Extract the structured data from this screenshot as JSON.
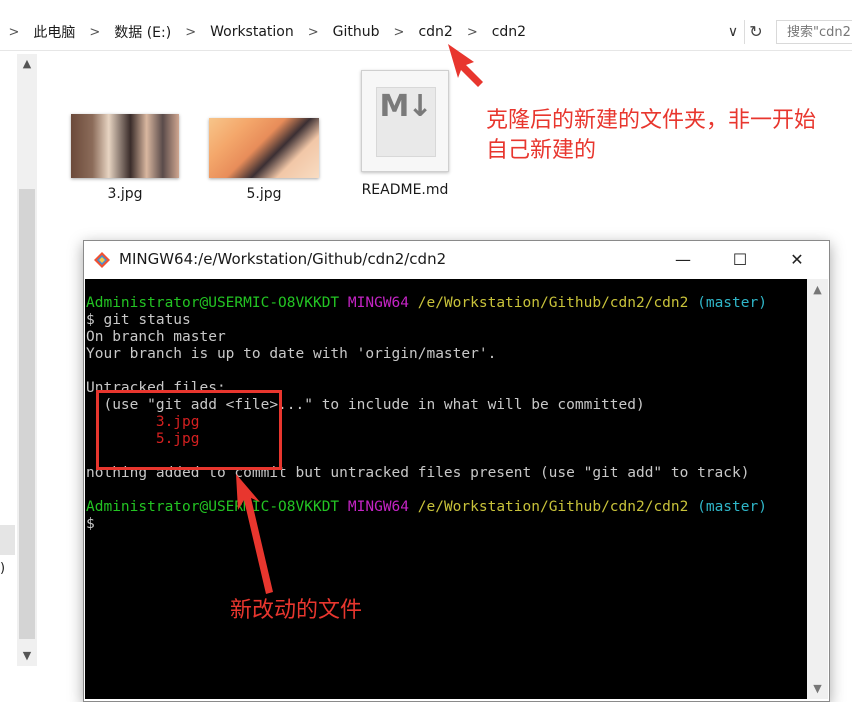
{
  "address_bar": {
    "crumbs": [
      "此电脑",
      "数据 (E:)",
      "Workstation",
      "Github",
      "cdn2",
      "cdn2"
    ],
    "separator": ">",
    "dropdown_glyph": "∨",
    "refresh_glyph": "↻",
    "search_placeholder": "搜索\"cdn2\""
  },
  "left_pane": {
    "partial_text": ")"
  },
  "files": [
    {
      "name": "3.jpg",
      "type": "image"
    },
    {
      "name": "5.jpg",
      "type": "image"
    },
    {
      "name": "README.md",
      "type": "markdown",
      "icon_mark": "M↓"
    }
  ],
  "annotations": {
    "top_note_line1": "克隆后的新建的文件夹，非一开始",
    "top_note_line2": "自己新建的",
    "bottom_note": "新改动的文件",
    "color": "#e8362e"
  },
  "terminal": {
    "title": "MINGW64:/e/Workstation/Github/cdn2/cdn2",
    "buttons": {
      "minimize": "—",
      "maximize": "☐",
      "close": "✕"
    },
    "prompt_user": "Administrator@USERMIC-O8VKKDT",
    "prompt_shell": "MINGW64",
    "prompt_path": "/e/Workstation/Github/cdn2/cdn2",
    "prompt_branch": "(master)",
    "command": "$ git status",
    "out1": "On branch master",
    "out2": "Your branch is up to date with 'origin/master'.",
    "out3": "Untracked files:",
    "out4": "  (use \"git add <file>...\" to include in what will be committed)",
    "untracked": [
      "        3.jpg",
      "        5.jpg"
    ],
    "out5": "nothing added to commit but untracked files present (use \"git add\" to track)",
    "cursor_prompt": "$"
  }
}
